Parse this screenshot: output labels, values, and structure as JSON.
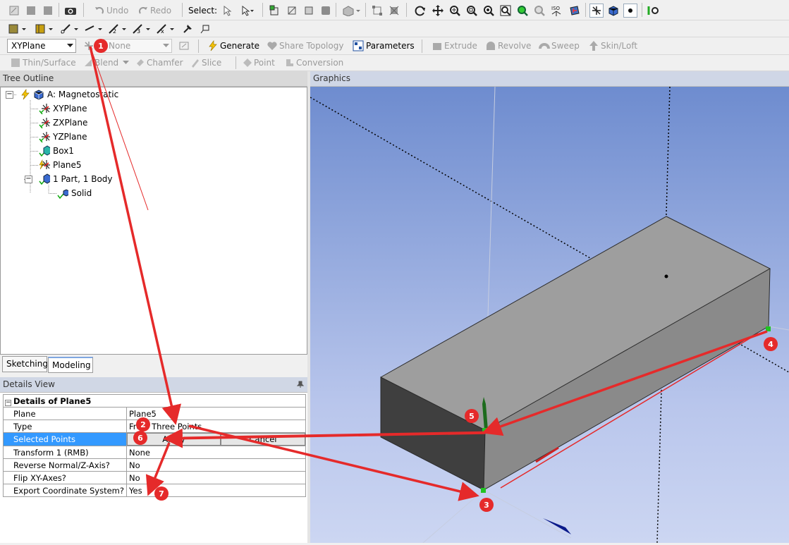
{
  "toolbar1": {
    "undo": "Undo",
    "redo": "Redo",
    "select_label": "Select:"
  },
  "toolbar3": {
    "plane_value": "XYPlane",
    "sketch_value": "None",
    "generate": "Generate",
    "share_topology": "Share Topology",
    "parameters": "Parameters",
    "extrude": "Extrude",
    "revolve": "Revolve",
    "sweep": "Sweep",
    "skin_loft": "Skin/Loft"
  },
  "toolbar4": {
    "thin_surface": "Thin/Surface",
    "blend": "Blend",
    "chamfer": "Chamfer",
    "slice": "Slice",
    "point": "Point",
    "conversion": "Conversion"
  },
  "tree": {
    "title": "Tree Outline",
    "items": [
      {
        "label": "A: Magnetostatic"
      },
      {
        "label": "XYPlane"
      },
      {
        "label": "ZXPlane"
      },
      {
        "label": "YZPlane"
      },
      {
        "label": "Box1"
      },
      {
        "label": "Plane5"
      },
      {
        "label": "1 Part, 1 Body"
      },
      {
        "label": "Solid"
      }
    ]
  },
  "tabs": {
    "sketching": "Sketching",
    "modeling": "Modeling"
  },
  "details": {
    "title": "Details View",
    "section": "Details of Plane5",
    "rows": [
      {
        "key": "Plane",
        "value": "Plane5"
      },
      {
        "key": "Type",
        "value": "From Three Points"
      },
      {
        "key": "Selected Points",
        "value": ""
      },
      {
        "key": "Transform 1 (RMB)",
        "value": "None"
      },
      {
        "key": "Reverse Normal/Z-Axis?",
        "value": "No"
      },
      {
        "key": "Flip XY-Axes?",
        "value": "No"
      },
      {
        "key": "Export Coordinate System?",
        "value": "Yes"
      }
    ],
    "apply": "Apply",
    "cancel": "Cancel"
  },
  "graphics": {
    "title": "Graphics"
  },
  "callouts": [
    "1",
    "2",
    "3",
    "4",
    "5",
    "6",
    "7"
  ],
  "colors": {
    "accent_red": "#e52a2a",
    "point_green": "#22c322",
    "viewport_top": "#6e8ccf",
    "selection_blue": "#3399ff"
  }
}
